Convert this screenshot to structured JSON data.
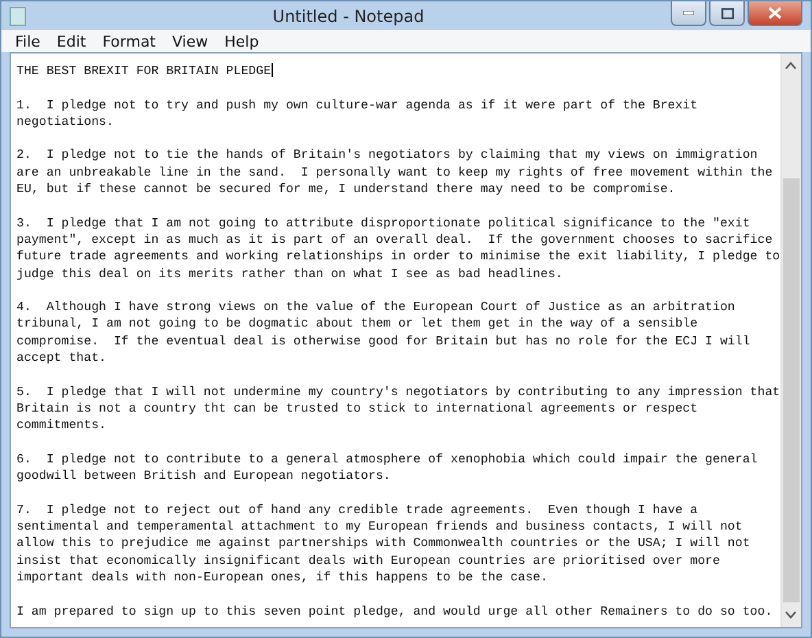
{
  "window": {
    "title": "Untitled - Notepad"
  },
  "menu": [
    "File",
    "Edit",
    "Format",
    "View",
    "Help"
  ],
  "document": {
    "title": "THE BEST BREXIT FOR BRITAIN PLEDGE",
    "paragraphs": [
      [
        "1.  I pledge not to try and push my own culture-war agenda as if it were part of the Brexit",
        "negotiations."
      ],
      [
        "2.  I pledge not to tie the hands of Britain's negotiators by claiming that my views on immigration",
        "are an unbreakable line in the sand.  I personally want to keep my rights of free movement within the",
        "EU, but if these cannot be secured for me, I understand there may need to be compromise."
      ],
      [
        "3.  I pledge that I am not going to attribute disproportionate political significance to the \"exit",
        "payment\", except in as much as it is part of an overall deal.  If the government chooses to sacrifice",
        "future trade agreements and working relationships in order to minimise the exit liability, I pledge to",
        "judge this deal on its merits rather than on what I see as bad headlines."
      ],
      [
        "4.  Although I have strong views on the value of the European Court of Justice as an arbitration",
        "tribunal, I am not going to be dogmatic about them or let them get in the way of a sensible",
        "compromise.  If the eventual deal is otherwise good for Britain but has no role for the ECJ I will",
        "accept that."
      ],
      [
        "5.  I pledge that I will not undermine my country's negotiators by contributing to any impression that",
        "Britain is not a country tht can be trusted to stick to international agreements or respect",
        "commitments."
      ],
      [
        "6.  I pledge not to contribute to a general atmosphere of xenophobia which could impair the general",
        "goodwill between British and European negotiators."
      ],
      [
        "7.  I pledge not to reject out of hand any credible trade agreements.  Even though I have a",
        "sentimental and temperamental attachment to my European friends and business contacts, I will not",
        "allow this to prejudice me against partnerships with Commonwealth countries or the USA; I will not",
        "insist that economically insignificant deals with European countries are prioritised over more",
        "important deals with non-European ones, if this happens to be the case."
      ],
      [
        "I am prepared to sign up to this seven point pledge, and would urge all other Remainers to do so too."
      ]
    ]
  }
}
